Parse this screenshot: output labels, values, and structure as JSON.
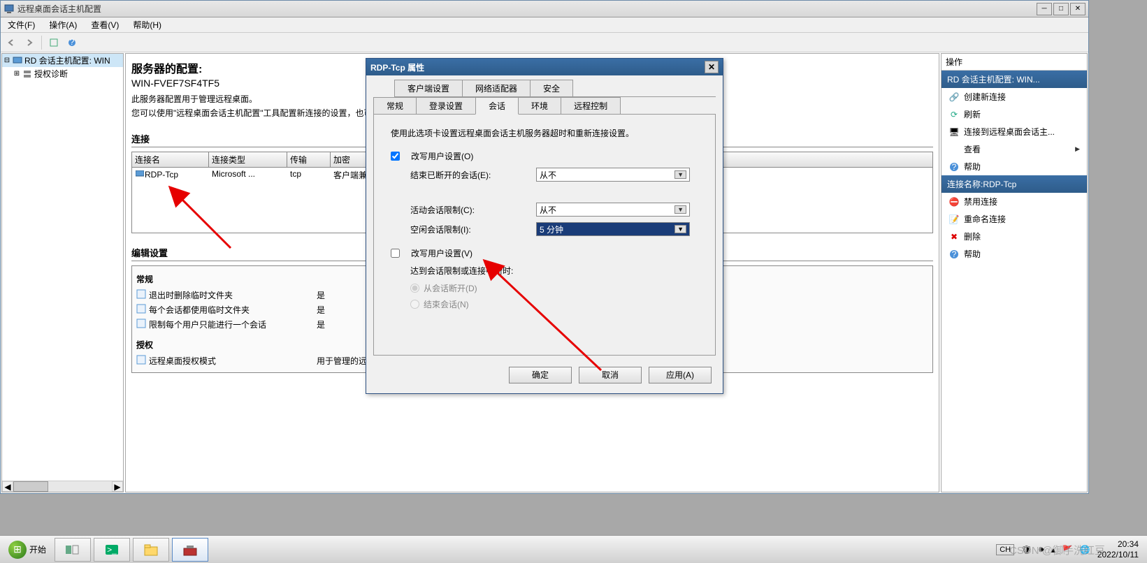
{
  "window": {
    "title": "远程桌面会话主机配置",
    "menubar": [
      "文件(F)",
      "操作(A)",
      "查看(V)",
      "帮助(H)"
    ]
  },
  "tree": {
    "root": "RD 会话主机配置: WIN",
    "child": "授权诊断"
  },
  "center": {
    "heading": "服务器的配置:",
    "hostname": "WIN-FVEF7SF4TF5",
    "desc1": "此服务器配置用于管理远程桌面。",
    "desc2": "您可以使用\"远程桌面会话主机配置\"工具配置新连接的设置，也可以将服务器作为整体配置其设置。",
    "connections_title": "连接",
    "headers": {
      "name": "连接名",
      "type": "连接类型",
      "trans": "传输",
      "enc": "加密"
    },
    "conn": {
      "name": "RDP-Tcp",
      "type": "Microsoft ...",
      "trans": "tcp",
      "enc": "客户端兼"
    },
    "edit_settings_title": "编辑设置",
    "general_sub": "常规",
    "gen1": {
      "label": "退出时删除临时文件夹",
      "val": "是"
    },
    "gen2": {
      "label": "每个会话都使用临时文件夹",
      "val": "是"
    },
    "gen3": {
      "label": "限制每个用户只能进行一个会话",
      "val": "是"
    },
    "auth_sub": "授权",
    "auth1": {
      "label": "远程桌面授权模式",
      "val": "用于管理的远程"
    }
  },
  "actions": {
    "title": "操作",
    "section1_heading": "RD 会话主机配置: WIN...",
    "items1": [
      {
        "icon": "link-icon",
        "label": "创建新连接"
      },
      {
        "icon": "refresh-icon",
        "label": "刷新"
      },
      {
        "icon": "connect-icon",
        "label": "连接到远程桌面会话主..."
      },
      {
        "icon": "",
        "label": "查看",
        "arrow": true
      },
      {
        "icon": "help-icon",
        "label": "帮助"
      }
    ],
    "section2_heading": "连接名称:RDP-Tcp",
    "items2": [
      {
        "icon": "disable-icon",
        "label": "禁用连接"
      },
      {
        "icon": "rename-icon",
        "label": "重命名连接"
      },
      {
        "icon": "delete-icon",
        "label": "删除"
      },
      {
        "icon": "help-icon",
        "label": "帮助"
      }
    ]
  },
  "dialog": {
    "title": "RDP-Tcp 属性",
    "tabs_row1": [
      "客户端设置",
      "网络适配器",
      "安全"
    ],
    "tabs_row2": [
      "常规",
      "登录设置",
      "会话",
      "环境",
      "远程控制"
    ],
    "active_tab": "会话",
    "pane_desc": "使用此选项卡设置远程桌面会话主机服务器超时和重新连接设置。",
    "override1": "改写用户设置(O)",
    "end_disconnected": {
      "label": "结束已断开的会话(E):",
      "value": "从不"
    },
    "active_limit": {
      "label": "活动会话限制(C):",
      "value": "从不"
    },
    "idle_limit": {
      "label": "空闲会话限制(I):",
      "value": "5 分钟"
    },
    "override2": "改写用户设置(V)",
    "reach_label": "达到会话限制或连接中断时:",
    "radio1": "从会话断开(D)",
    "radio2": "结束会话(N)",
    "buttons": {
      "ok": "确定",
      "cancel": "取消",
      "apply": "应用(A)"
    }
  },
  "taskbar": {
    "start": "开始",
    "lang": "CH",
    "time": "20:34",
    "date": "2022/10/11",
    "watermark": "CSDN @御⼿洗红豆"
  }
}
